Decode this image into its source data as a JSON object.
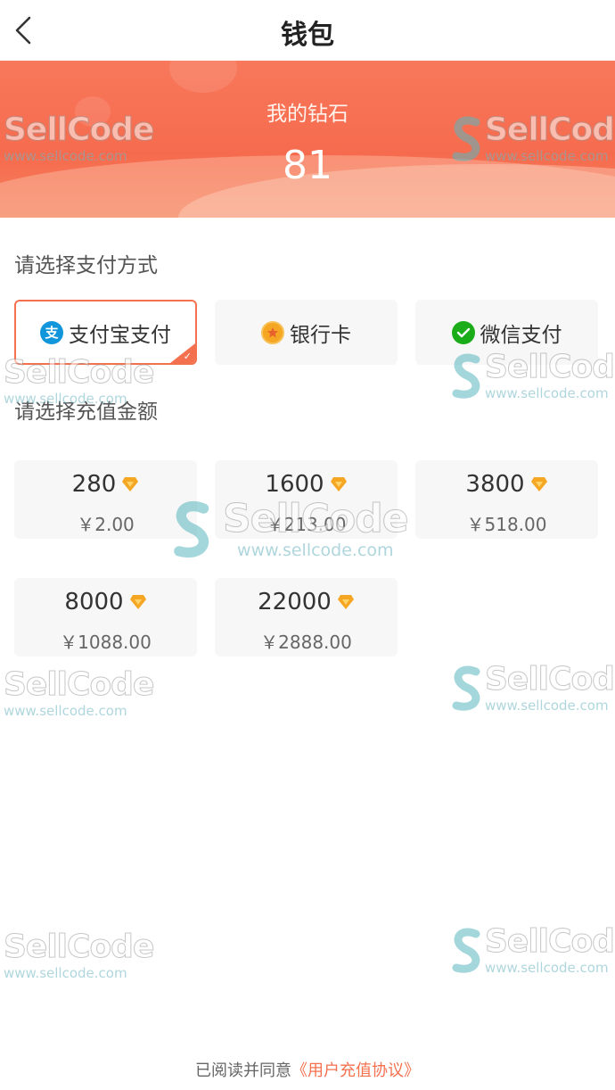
{
  "header": {
    "title": "钱包"
  },
  "balance": {
    "label": "我的钻石",
    "value": "81"
  },
  "payment": {
    "section_label": "请选择支付方式",
    "methods": [
      {
        "label": "支付宝支付",
        "icon": "alipay-icon",
        "icon_glyph": "支",
        "selected": true
      },
      {
        "label": "银行卡",
        "icon": "bank-card-icon",
        "selected": false
      },
      {
        "label": "微信支付",
        "icon": "wechat-icon",
        "selected": false
      }
    ]
  },
  "recharge": {
    "section_label": "请选择充值金额",
    "options": [
      {
        "diamonds": "280",
        "price": "￥2.00"
      },
      {
        "diamonds": "1600",
        "price": "￥213.00"
      },
      {
        "diamonds": "3800",
        "price": "￥518.00"
      },
      {
        "diamonds": "8000",
        "price": "￥1088.00"
      },
      {
        "diamonds": "22000",
        "price": "￥2888.00"
      }
    ]
  },
  "footer": {
    "prefix": "已阅读并同意",
    "link": "《用户充值协议》"
  },
  "watermark": {
    "brand": "SellCode",
    "url": "www.sellcode.com"
  },
  "colors": {
    "accent": "#f4714f",
    "diamond": "#f5a623",
    "wechat": "#1aad19",
    "alipay": "#1296db"
  }
}
